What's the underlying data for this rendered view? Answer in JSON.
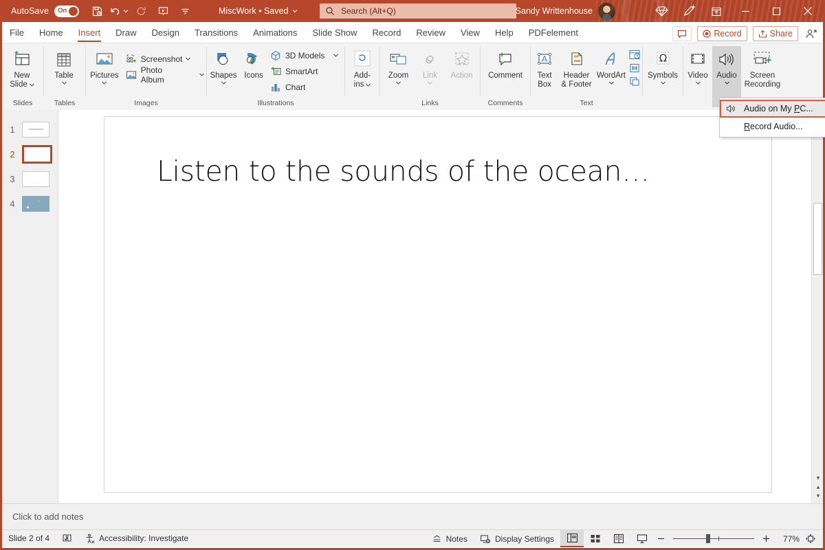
{
  "titlebar": {
    "autosave_label": "AutoSave",
    "autosave_state": "On",
    "document_name": "MiscWork • Saved",
    "search_placeholder": "Search (Alt+Q)",
    "user_name": "Sandy Writtenhouse",
    "icons": {
      "save": "save-icon",
      "undo": "undo-icon",
      "redo": "redo-icon",
      "present": "start-presentation-icon",
      "customize": "customize-quick-access-icon",
      "diamond": "diamond-icon",
      "designer": "designer-pen-icon",
      "ribbon_display": "ribbon-display-options-icon",
      "minimize": "minimize-icon",
      "maximize": "maximize-icon",
      "close": "close-icon"
    }
  },
  "tabs": [
    {
      "label": "File",
      "active": false
    },
    {
      "label": "Home",
      "active": false
    },
    {
      "label": "Insert",
      "active": true
    },
    {
      "label": "Draw",
      "active": false
    },
    {
      "label": "Design",
      "active": false
    },
    {
      "label": "Transitions",
      "active": false
    },
    {
      "label": "Animations",
      "active": false
    },
    {
      "label": "Slide Show",
      "active": false
    },
    {
      "label": "Record",
      "active": false
    },
    {
      "label": "Review",
      "active": false
    },
    {
      "label": "View",
      "active": false
    },
    {
      "label": "Help",
      "active": false
    },
    {
      "label": "PDFelement",
      "active": false
    }
  ],
  "tab_actions": {
    "comments_label": "",
    "record_label": "Record",
    "share_label": "Share"
  },
  "ribbon": {
    "groups": [
      {
        "name": "Slides",
        "label": "Slides",
        "buttons": [
          {
            "label_line1": "New",
            "label_line2": "Slide",
            "icon": "new-slide-icon",
            "has_chevron": true
          }
        ]
      },
      {
        "name": "Tables",
        "label": "Tables",
        "buttons": [
          {
            "label_line1": "Table",
            "label_line2": "",
            "icon": "table-icon",
            "has_chevron": true
          }
        ]
      },
      {
        "name": "Images",
        "label": "Images",
        "buttons": [
          {
            "label_line1": "Pictures",
            "label_line2": "",
            "icon": "pictures-icon",
            "has_chevron": true
          }
        ],
        "small_items": [
          {
            "label": "Screenshot",
            "icon": "screenshot-icon",
            "has_chevron": true
          },
          {
            "label": "Photo Album",
            "icon": "photo-album-icon",
            "has_chevron": true
          }
        ]
      },
      {
        "name": "Illustrations",
        "label": "Illustrations",
        "buttons": [
          {
            "label_line1": "Shapes",
            "label_line2": "",
            "icon": "shapes-icon",
            "has_chevron": true
          },
          {
            "label_line1": "Icons",
            "label_line2": "",
            "icon": "icons-icon",
            "has_chevron": false
          }
        ],
        "small_items": [
          {
            "label": "3D Models",
            "icon": "3d-models-icon",
            "has_chevron": true
          },
          {
            "label": "SmartArt",
            "icon": "smartart-icon",
            "has_chevron": false
          },
          {
            "label": "Chart",
            "icon": "chart-icon",
            "has_chevron": false
          }
        ]
      },
      {
        "name": "Add-ins",
        "label": "",
        "buttons": [
          {
            "label_line1": "Add-",
            "label_line2": "ins",
            "icon": "add-ins-icon",
            "has_chevron": true
          }
        ]
      },
      {
        "name": "Links",
        "label": "Links",
        "buttons": [
          {
            "label_line1": "Zoom",
            "label_line2": "",
            "icon": "zoom-icon",
            "has_chevron": true
          },
          {
            "label_line1": "Link",
            "label_line2": "",
            "icon": "link-icon",
            "has_chevron": true,
            "disabled": true
          },
          {
            "label_line1": "Action",
            "label_line2": "",
            "icon": "action-icon",
            "has_chevron": false,
            "disabled": true
          }
        ]
      },
      {
        "name": "Comments",
        "label": "Comments",
        "buttons": [
          {
            "label_line1": "Comment",
            "label_line2": "",
            "icon": "comment-icon",
            "has_chevron": false
          }
        ]
      },
      {
        "name": "Text",
        "label": "Text",
        "buttons": [
          {
            "label_line1": "Text",
            "label_line2": "Box",
            "icon": "text-box-icon",
            "has_chevron": false
          },
          {
            "label_line1": "Header",
            "label_line2": "& Footer",
            "icon": "header-footer-icon",
            "has_chevron": false
          },
          {
            "label_line1": "WordArt",
            "label_line2": "",
            "icon": "wordart-icon",
            "has_chevron": true
          }
        ],
        "stack_icons": [
          "date-time-icon",
          "slide-number-icon",
          "object-icon"
        ]
      },
      {
        "name": "Symbols",
        "label": "",
        "buttons": [
          {
            "label_line1": "Symbols",
            "label_line2": "",
            "icon": "symbols-omega-icon",
            "has_chevron": true
          }
        ]
      },
      {
        "name": "Media",
        "label": "",
        "buttons": [
          {
            "label_line1": "Video",
            "label_line2": "",
            "icon": "video-icon",
            "has_chevron": true
          },
          {
            "label_line1": "Audio",
            "label_line2": "",
            "icon": "audio-speaker-icon",
            "has_chevron": true,
            "active": true
          },
          {
            "label_line1": "Screen",
            "label_line2": "Recording",
            "icon": "screen-recording-icon",
            "has_chevron": false
          }
        ]
      }
    ]
  },
  "audio_menu": {
    "items": [
      {
        "label_pre": "Audio on My ",
        "accel": "P",
        "label_post": "C...",
        "icon": "audio-speaker-icon",
        "highlighted": true
      },
      {
        "label_pre": "",
        "accel": "R",
        "label_post": "ecord Audio...",
        "icon": "",
        "highlighted": false
      }
    ]
  },
  "thumbnails": [
    {
      "number": "1",
      "selected": false,
      "style": "text"
    },
    {
      "number": "2",
      "selected": true,
      "style": "blank"
    },
    {
      "number": "3",
      "selected": false,
      "style": "blank"
    },
    {
      "number": "4",
      "selected": false,
      "style": "sea"
    }
  ],
  "slide": {
    "title": "Listen to the sounds of the ocean…"
  },
  "notes": {
    "placeholder": "Click to add notes"
  },
  "statusbar": {
    "slide_indicator": "Slide 2 of 4",
    "accessibility": "Accessibility: Investigate",
    "notes_label": "Notes",
    "display_settings_label": "Display Settings",
    "zoom_percent": "77%",
    "icons": {
      "language": "language-book-icon",
      "accessibility": "accessibility-icon",
      "notes": "notes-icon",
      "display_settings": "display-settings-icon",
      "normal_view": "normal-view-icon",
      "slide_sorter": "slide-sorter-icon",
      "reading_view": "reading-view-icon",
      "slideshow": "slideshow-icon",
      "zoom_out": "zoom-out-icon",
      "zoom_in": "zoom-in-icon",
      "fit_slide": "fit-slide-to-window-icon"
    }
  },
  "colors": {
    "brand": "#b7472a",
    "ribbon_bg": "#f3f3f3",
    "highlight": "#f2552c"
  }
}
